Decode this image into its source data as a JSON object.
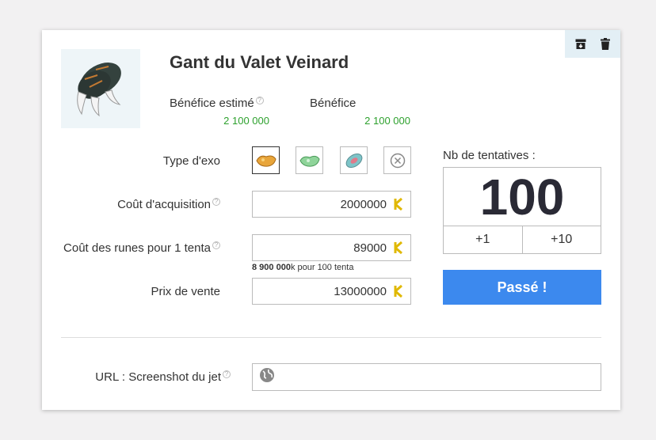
{
  "item": {
    "name": "Gant du Valet Veinard"
  },
  "stats": {
    "estimated_label": "Bénéfice estimé",
    "estimated_value": "2 100 000",
    "profit_label": "Bénéfice",
    "profit_value": "2 100 000"
  },
  "form": {
    "exo_label": "Type d'exo",
    "acquisition_label": "Coût d'acquisition",
    "acquisition_value": "2000000",
    "runes_label": "Coût des runes pour 1 tenta",
    "runes_value": "89000",
    "runes_note_bold": "8 900 000",
    "runes_note_rest": "k pour 100 tenta",
    "sale_label": "Prix de vente",
    "sale_value": "13000000",
    "url_label": "URL : Screenshot du jet",
    "url_value": ""
  },
  "counter": {
    "label": "Nb de tentatives :",
    "value": "100",
    "plus1": "+1",
    "plus10": "+10"
  },
  "passe_label": "Passé !",
  "colors": {
    "accent": "#3c89ee",
    "profit": "#2ea12e"
  }
}
